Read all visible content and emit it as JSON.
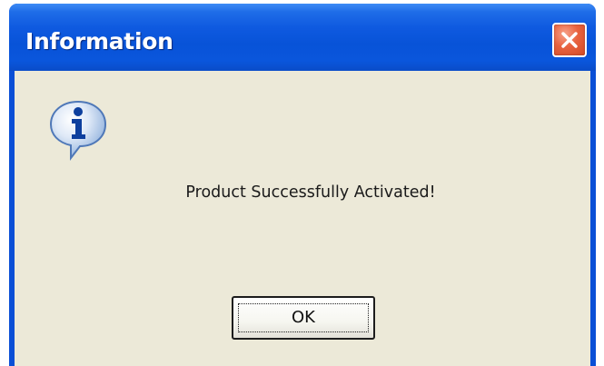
{
  "dialog": {
    "title": "Information",
    "close_icon": "close-icon",
    "message_icon": "information-icon",
    "message": "Product Successfully Activated!",
    "ok_label": "OK"
  },
  "colors": {
    "titlebar": "#0853d8",
    "client_background": "#ece9d8",
    "close_button": "#e8623f"
  }
}
